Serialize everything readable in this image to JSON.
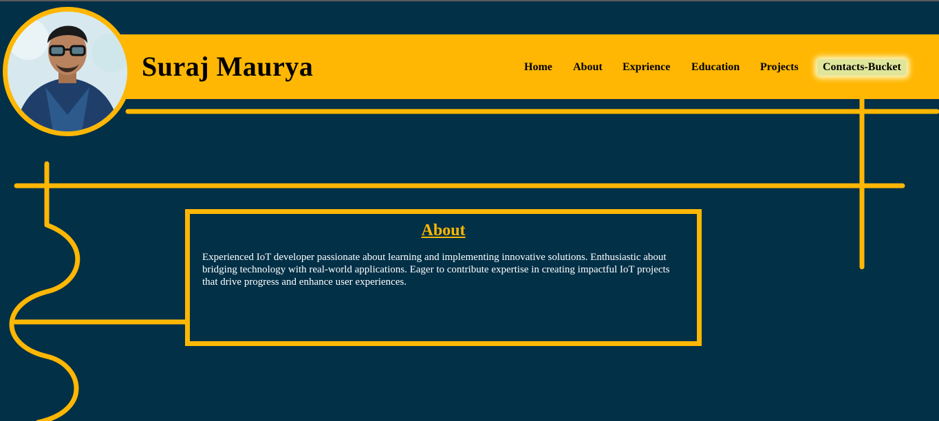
{
  "header": {
    "title": "Suraj Maurya",
    "avatar_alt": "profile photo"
  },
  "nav": {
    "items": [
      {
        "label": "Home"
      },
      {
        "label": "About"
      },
      {
        "label": "Exprience"
      },
      {
        "label": "Education"
      },
      {
        "label": "Projects"
      },
      {
        "label": "Contacts-Bucket"
      }
    ]
  },
  "about": {
    "title": "About",
    "text": "Experienced IoT developer passionate about learning and implementing innovative solutions. Enthusiastic about bridging technology with real-world applications. Eager to contribute expertise in creating impactful IoT projects that drive progress and enhance user experiences."
  },
  "colors": {
    "background": "#013047",
    "accent": "#ffb703",
    "highlight": "#dfe69a",
    "text_light": "#ffffff"
  }
}
